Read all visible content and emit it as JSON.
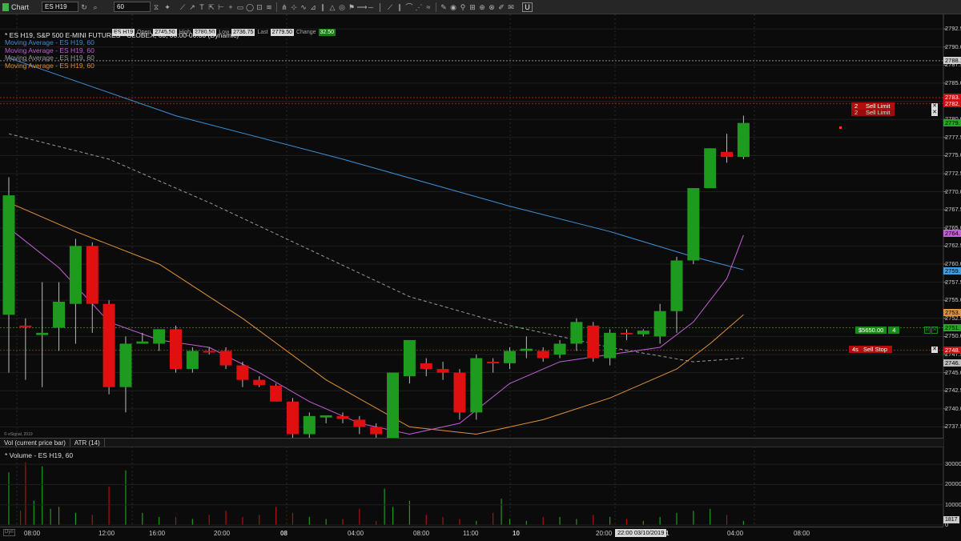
{
  "window": {
    "title": "Chart"
  },
  "toolbar": {
    "symbol": "ES H19",
    "interval": "60",
    "nav_icons": [
      "refresh-icon",
      "search-icon",
      "hourglass-icon",
      "twitter-icon"
    ],
    "tools": [
      "line-tool",
      "arrow-tool",
      "text-tool",
      "pointer-tool",
      "ruler-tool",
      "cross-tool",
      "rectangle-tool",
      "ellipse-tool",
      "label-tool",
      "fib-tool",
      "pitchfork-tool",
      "gann-tool",
      "wave-tool",
      "measure-tool",
      "channel-tool",
      "triangle-tool",
      "cycle-tool",
      "alert-tool",
      "ray-tool",
      "hline-tool",
      "vline-tool",
      "trend-tool",
      "parallel-tool",
      "arc-tool",
      "speed-tool",
      "regression-tool",
      "brush-tool",
      "eye-tool",
      "link-tool",
      "grid-tool",
      "zoom-tool",
      "magnet-tool",
      "pencil-tool",
      "comment-tool"
    ],
    "u_button": "U"
  },
  "header": {
    "symbol_tag": "ES H19",
    "open_label": "Open",
    "open": "2745.50",
    "high_label": "High",
    "high": "2780.50",
    "low_label": "Low",
    "low": "2736.75",
    "last_label": "Last",
    "last": "2779.50",
    "change_label": "Change",
    "change": "32.50",
    "title": "* ES H19, S&P 500 E-MINI FUTURES - GLOBEX, 60, 00:00-00:00 (Dynamic)",
    "legend": [
      {
        "label": "Moving Average - ES H19, 60",
        "color": "#3f8fd6"
      },
      {
        "label": "Moving Average - ES H19, 60",
        "color": "#c35fd6"
      },
      {
        "label": "Moving Average - ES H19, 60",
        "color": "#9a9a9a"
      },
      {
        "label": "Moving Average - ES H19, 60",
        "color": "#e0913a"
      }
    ]
  },
  "price_scale": {
    "ticks": [
      "2792.5",
      "2790.0",
      "2787.5",
      "2785.0",
      "2782.5",
      "2780.0",
      "2777.5",
      "2775.0",
      "2772.5",
      "2770.0",
      "2767.5",
      "2765.0",
      "2762.5",
      "2760.0",
      "2757.5",
      "2755.0",
      "2752.5",
      "2750.0",
      "2747.5",
      "2745.0",
      "2742.5",
      "2740.0",
      "2737.5"
    ],
    "tags": [
      {
        "text": "2788.1",
        "price": 2788.1,
        "bg": "#cfcfcf"
      },
      {
        "text": "2783.",
        "price": 2783.0,
        "bg": "#c31414"
      },
      {
        "text": "2782.",
        "price": 2782.2,
        "bg": "#c31414"
      },
      {
        "text": "2779.",
        "price": 2779.5,
        "bg": "#2aa52a"
      },
      {
        "text": "2764.",
        "price": 2764.2,
        "bg": "#c35fd6"
      },
      {
        "text": "2759.",
        "price": 2759.1,
        "bg": "#3f9fe0"
      },
      {
        "text": "2753.",
        "price": 2753.3,
        "bg": "#e0913a"
      },
      {
        "text": "2751.",
        "price": 2751.2,
        "bg": "#2aa52a"
      },
      {
        "text": "2748.",
        "price": 2748.1,
        "bg": "#c31414"
      },
      {
        "text": "2746.",
        "price": 2746.3,
        "bg": "#bdbdbd"
      }
    ]
  },
  "orders": {
    "sell_limit_1": {
      "qty": "2",
      "label": "Sell Limit",
      "price": 2783.0
    },
    "sell_limit_2": {
      "qty": "2",
      "label": "Sell Limit",
      "price": 2782.2
    },
    "sell_stop": {
      "qty": "4s",
      "label": "Sell Stop",
      "price": 2748.1
    },
    "position": {
      "pl": "$5650.00",
      "qty": "4",
      "price": 2751.2
    },
    "close_symbol": "✕",
    "r_symbol": "R"
  },
  "watermark": "© eSignal, 2019",
  "tabs": [
    "Vol (current price bar)",
    "ATR (14)"
  ],
  "volume": {
    "title": "* Volume - ES H19, 60",
    "ticks": [
      "30000",
      "20000",
      "10000",
      "0"
    ],
    "last_tag": "1817"
  },
  "time_axis": {
    "dyn": "Dyn",
    "crosshair": "22:00 03/10/2019",
    "ticks": [
      {
        "label": "08:00",
        "bold": false
      },
      {
        "label": "12:00",
        "bold": false
      },
      {
        "label": "16:00",
        "bold": false
      },
      {
        "label": "20:00",
        "bold": false
      },
      {
        "label": "08",
        "bold": true
      },
      {
        "label": "04:00",
        "bold": false
      },
      {
        "label": "08:00",
        "bold": false
      },
      {
        "label": "11:00",
        "bold": false
      },
      {
        "label": "10",
        "bold": true
      },
      {
        "label": "20:00",
        "bold": false
      },
      {
        "label": "11",
        "bold": true
      },
      {
        "label": "04:00",
        "bold": false
      },
      {
        "label": "08:00",
        "bold": false
      }
    ]
  },
  "chart_data": {
    "type": "candlestick",
    "symbol": "ES H19",
    "interval": "60",
    "ylim": [
      2736.0,
      2794.5
    ],
    "candles": [
      {
        "o": 2753.0,
        "h": 2772.0,
        "l": 2745.0,
        "c": 2769.5
      },
      {
        "o": 2751.5,
        "h": 2752.5,
        "l": 2744.0,
        "c": 2751.3
      },
      {
        "o": 2750.2,
        "h": 2757.5,
        "l": 2743.0,
        "c": 2750.5
      },
      {
        "o": 2751.2,
        "h": 2757.5,
        "l": 2748.0,
        "c": 2754.8
      },
      {
        "o": 2754.5,
        "h": 2763.5,
        "l": 2749.0,
        "c": 2762.5
      },
      {
        "o": 2762.5,
        "h": 2763.0,
        "l": 2750.5,
        "c": 2754.5
      },
      {
        "o": 2754.5,
        "h": 2755.0,
        "l": 2742.0,
        "c": 2743.0
      },
      {
        "o": 2743.0,
        "h": 2750.0,
        "l": 2739.5,
        "c": 2749.0
      },
      {
        "o": 2749.0,
        "h": 2750.5,
        "l": 2749.0,
        "c": 2749.3
      },
      {
        "o": 2749.0,
        "h": 2751.0,
        "l": 2748.0,
        "c": 2751.0
      },
      {
        "o": 2751.0,
        "h": 2751.5,
        "l": 2745.0,
        "c": 2745.5
      },
      {
        "o": 2745.5,
        "h": 2748.5,
        "l": 2745.0,
        "c": 2748.0
      },
      {
        "o": 2748.0,
        "h": 2748.5,
        "l": 2747.5,
        "c": 2747.8
      },
      {
        "o": 2748.0,
        "h": 2748.5,
        "l": 2745.5,
        "c": 2746.0
      },
      {
        "o": 2746.0,
        "h": 2746.5,
        "l": 2743.0,
        "c": 2744.0
      },
      {
        "o": 2744.0,
        "h": 2744.5,
        "l": 2743.0,
        "c": 2743.3
      },
      {
        "o": 2743.2,
        "h": 2743.5,
        "l": 2741.0,
        "c": 2741.0
      },
      {
        "o": 2741.0,
        "h": 2741.5,
        "l": 2736.0,
        "c": 2736.5
      },
      {
        "o": 2736.5,
        "h": 2739.5,
        "l": 2736.0,
        "c": 2739.0
      },
      {
        "o": 2738.8,
        "h": 2739.0,
        "l": 2738.0,
        "c": 2739.1
      },
      {
        "o": 2739.0,
        "h": 2739.5,
        "l": 2738.0,
        "c": 2738.6
      },
      {
        "o": 2738.5,
        "h": 2739.0,
        "l": 2736.5,
        "c": 2737.5
      },
      {
        "o": 2737.5,
        "h": 2738.0,
        "l": 2736.0,
        "c": 2736.5
      },
      {
        "o": 2736.0,
        "h": 2745.0,
        "l": 2736.0,
        "c": 2745.0
      },
      {
        "o": 2744.5,
        "h": 2749.5,
        "l": 2743.5,
        "c": 2749.5
      },
      {
        "o": 2746.3,
        "h": 2747.0,
        "l": 2744.5,
        "c": 2745.5
      },
      {
        "o": 2745.5,
        "h": 2746.5,
        "l": 2744.0,
        "c": 2745.0
      },
      {
        "o": 2745.0,
        "h": 2745.5,
        "l": 2738.5,
        "c": 2739.5
      },
      {
        "o": 2739.5,
        "h": 2747.5,
        "l": 2738.5,
        "c": 2747.0
      },
      {
        "o": 2746.5,
        "h": 2747.0,
        "l": 2745.0,
        "c": 2746.3
      },
      {
        "o": 2746.3,
        "h": 2748.5,
        "l": 2745.5,
        "c": 2748.0
      },
      {
        "o": 2748.0,
        "h": 2750.0,
        "l": 2747.0,
        "c": 2748.3
      },
      {
        "o": 2748.0,
        "h": 2748.5,
        "l": 2746.5,
        "c": 2747.0
      },
      {
        "o": 2747.5,
        "h": 2749.5,
        "l": 2747.0,
        "c": 2749.0
      },
      {
        "o": 2749.0,
        "h": 2752.5,
        "l": 2748.0,
        "c": 2752.0
      },
      {
        "o": 2751.5,
        "h": 2752.0,
        "l": 2746.5,
        "c": 2747.0
      },
      {
        "o": 2747.0,
        "h": 2751.0,
        "l": 2746.0,
        "c": 2750.5
      },
      {
        "o": 2750.5,
        "h": 2751.0,
        "l": 2749.5,
        "c": 2750.3
      },
      {
        "o": 2750.3,
        "h": 2751.0,
        "l": 2750.0,
        "c": 2750.8
      },
      {
        "o": 2750.0,
        "h": 2754.5,
        "l": 2749.0,
        "c": 2753.5
      },
      {
        "o": 2753.5,
        "h": 2761.0,
        "l": 2750.5,
        "c": 2760.5
      },
      {
        "o": 2760.5,
        "h": 2770.5,
        "l": 2760.0,
        "c": 2770.5
      },
      {
        "o": 2770.5,
        "h": 2776.0,
        "l": 2770.5,
        "c": 2776.0
      },
      {
        "o": 2775.5,
        "h": 2778.0,
        "l": 2774.0,
        "c": 2774.8
      },
      {
        "o": 2774.8,
        "h": 2780.5,
        "l": 2774.5,
        "c": 2779.5
      }
    ],
    "moving_averages": [
      {
        "color": "#3f8fd6",
        "points": [
          [
            0,
            2788.5
          ],
          [
            10,
            2780.5
          ],
          [
            20,
            2774.5
          ],
          [
            30,
            2768.0
          ],
          [
            36,
            2764.5
          ],
          [
            41,
            2761.0
          ],
          [
            44,
            2759.2
          ]
        ]
      },
      {
        "color": "#9a9a9a",
        "dashed": true,
        "points": [
          [
            0,
            2778.0
          ],
          [
            6,
            2774.5
          ],
          [
            12,
            2768.5
          ],
          [
            18,
            2762.0
          ],
          [
            24,
            2755.5
          ],
          [
            30,
            2751.5
          ],
          [
            36,
            2748.5
          ],
          [
            41,
            2746.5
          ],
          [
            44,
            2747.0
          ]
        ]
      },
      {
        "color": "#e0913a",
        "points": [
          [
            0,
            2768.5
          ],
          [
            4,
            2764.5
          ],
          [
            9,
            2760.0
          ],
          [
            14,
            2752.5
          ],
          [
            19,
            2744.0
          ],
          [
            24,
            2737.5
          ],
          [
            28,
            2736.5
          ],
          [
            32,
            2738.5
          ],
          [
            36,
            2741.5
          ],
          [
            40,
            2745.5
          ],
          [
            42,
            2749.0
          ],
          [
            44,
            2753.0
          ]
        ]
      },
      {
        "color": "#c35fd6",
        "points": [
          [
            0,
            2765.0
          ],
          [
            3,
            2759.5
          ],
          [
            6,
            2752.0
          ],
          [
            9,
            2749.5
          ],
          [
            12,
            2748.5
          ],
          [
            15,
            2745.0
          ],
          [
            18,
            2741.0
          ],
          [
            21,
            2738.0
          ],
          [
            24,
            2736.5
          ],
          [
            27,
            2738.0
          ],
          [
            30,
            2743.5
          ],
          [
            33,
            2746.5
          ],
          [
            36,
            2747.5
          ],
          [
            39,
            2748.5
          ],
          [
            41,
            2752.0
          ],
          [
            43,
            2758.0
          ],
          [
            44,
            2764.0
          ]
        ]
      }
    ],
    "volume": {
      "ylim": [
        0,
        36000
      ],
      "bars": [
        {
          "i": 0,
          "v": 26000
        },
        {
          "i": 0.7,
          "v": 7000
        },
        {
          "i": 1,
          "v": 31000
        },
        {
          "i": 1.5,
          "v": 12000
        },
        {
          "i": 2,
          "v": 29000
        },
        {
          "i": 2.5,
          "v": 8000
        },
        {
          "i": 3,
          "v": 9000
        },
        {
          "i": 4,
          "v": 6000
        },
        {
          "i": 5,
          "v": 5000
        },
        {
          "i": 6,
          "v": 19000
        },
        {
          "i": 7,
          "v": 27000
        },
        {
          "i": 8,
          "v": 6000
        },
        {
          "i": 9,
          "v": 4000
        },
        {
          "i": 10,
          "v": 4000
        },
        {
          "i": 11,
          "v": 3000
        },
        {
          "i": 12,
          "v": 5000
        },
        {
          "i": 13,
          "v": 7000
        },
        {
          "i": 14,
          "v": 4000
        },
        {
          "i": 15,
          "v": 5000
        },
        {
          "i": 16,
          "v": 9000
        },
        {
          "i": 17,
          "v": 6000
        },
        {
          "i": 18,
          "v": 4000
        },
        {
          "i": 19,
          "v": 3000
        },
        {
          "i": 20,
          "v": 3000
        },
        {
          "i": 21,
          "v": 8000
        },
        {
          "i": 22,
          "v": 2000
        },
        {
          "i": 22.5,
          "v": 18000
        },
        {
          "i": 23,
          "v": 9000
        },
        {
          "i": 24,
          "v": 12000
        },
        {
          "i": 25,
          "v": 5000
        },
        {
          "i": 26,
          "v": 4000
        },
        {
          "i": 27,
          "v": 3000
        },
        {
          "i": 28,
          "v": 2000
        },
        {
          "i": 29,
          "v": 6000
        },
        {
          "i": 29.5,
          "v": 13000
        },
        {
          "i": 30,
          "v": 3000
        },
        {
          "i": 31,
          "v": 2000
        },
        {
          "i": 32,
          "v": 4000
        },
        {
          "i": 33,
          "v": 4000
        },
        {
          "i": 34,
          "v": 3000
        },
        {
          "i": 35,
          "v": 5000
        },
        {
          "i": 36,
          "v": 4000
        },
        {
          "i": 37,
          "v": 3000
        },
        {
          "i": 38,
          "v": 2000
        },
        {
          "i": 39,
          "v": 4000
        },
        {
          "i": 40,
          "v": 6000
        },
        {
          "i": 41,
          "v": 7000
        },
        {
          "i": 42,
          "v": 8000
        },
        {
          "i": 43,
          "v": 5000
        },
        {
          "i": 44,
          "v": 2000
        }
      ]
    }
  }
}
